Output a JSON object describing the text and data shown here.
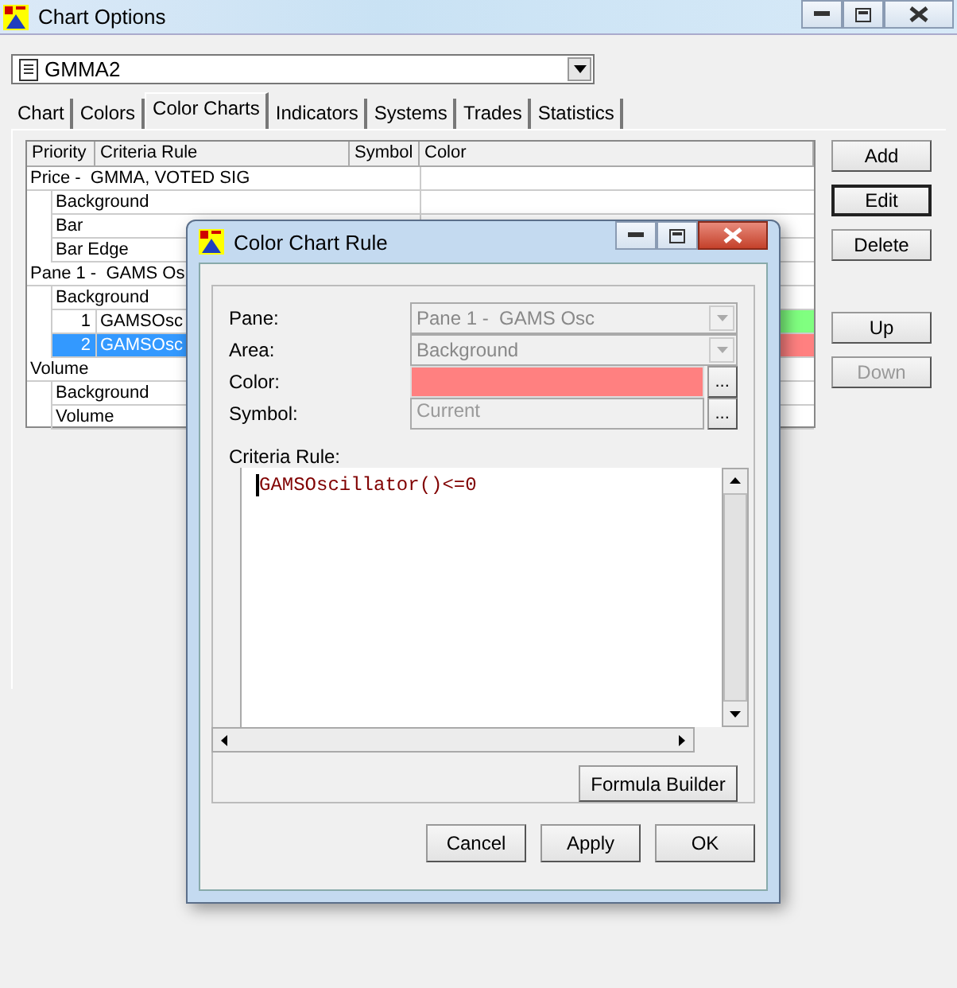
{
  "window": {
    "title": "Chart Options"
  },
  "chart_select": {
    "value": "GMMA2"
  },
  "tabs": [
    {
      "label": "Chart",
      "selected": false
    },
    {
      "label": "Colors",
      "selected": false
    },
    {
      "label": "Color Charts",
      "selected": true
    },
    {
      "label": "Indicators",
      "selected": false
    },
    {
      "label": "Systems",
      "selected": false
    },
    {
      "label": "Trades",
      "selected": false
    },
    {
      "label": "Statistics",
      "selected": false
    }
  ],
  "rules_table": {
    "columns": [
      "Priority",
      "Criteria Rule",
      "Symbol",
      "Color"
    ],
    "panes": [
      {
        "label": "Price -  GMMA, VOTED SIG",
        "areas": [
          {
            "label": "Background"
          },
          {
            "label": "Bar"
          },
          {
            "label": "Bar Edge"
          }
        ]
      },
      {
        "label": "Pane 1 -  GAMS Os",
        "areas": [
          {
            "label": "Background",
            "rules": [
              {
                "priority": "1",
                "criteria": "GAMSOsc",
                "color": "#80ff80",
                "selected": false
              },
              {
                "priority": "2",
                "criteria": "GAMSOsc",
                "color": "#ff8080",
                "selected": true
              }
            ]
          }
        ]
      },
      {
        "label": "Volume",
        "areas": [
          {
            "label": "Background"
          },
          {
            "label": "Volume"
          }
        ]
      }
    ]
  },
  "side_button_groups": [
    {
      "buttons": [
        {
          "label": "Add",
          "default": false,
          "disabled": false
        },
        {
          "label": "Edit",
          "default": true,
          "disabled": false
        },
        {
          "label": "Delete",
          "default": false,
          "disabled": false
        }
      ]
    },
    {
      "buttons": [
        {
          "label": "Up",
          "default": false,
          "disabled": false
        },
        {
          "label": "Down",
          "default": false,
          "disabled": true
        }
      ]
    }
  ],
  "dialog": {
    "title": "Color Chart Rule",
    "fields": [
      {
        "label": "Pane:",
        "kind": "dropdown",
        "value": "Pane 1 -  GAMS Osc",
        "disabled": true
      },
      {
        "label": "Area:",
        "kind": "dropdown",
        "value": "Background",
        "disabled": true
      },
      {
        "label": "Color:",
        "kind": "color",
        "color": "#ff8080",
        "browse": "..."
      },
      {
        "label": "Symbol:",
        "kind": "text",
        "value": "Current",
        "disabled": true,
        "browse": "..."
      }
    ],
    "criteria_label": "Criteria Rule:",
    "criteria_text": "GAMSOscillator()<=0",
    "formula_button": "Formula Builder",
    "buttons": [
      "Cancel",
      "Apply",
      "OK"
    ]
  }
}
